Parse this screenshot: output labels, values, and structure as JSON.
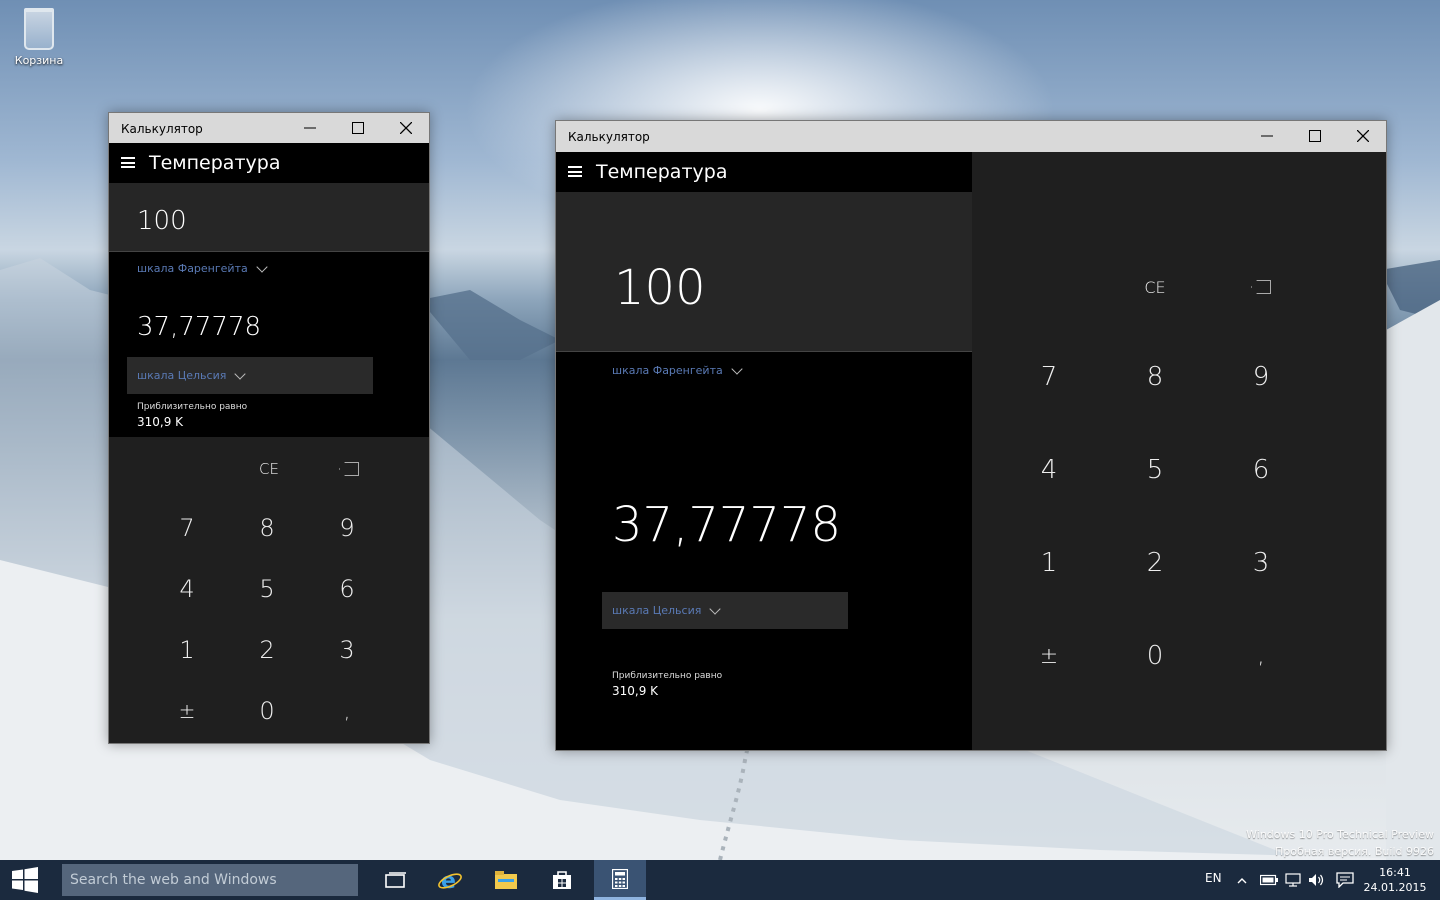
{
  "desktop": {
    "recycle_bin_label": "Корзина",
    "watermark_line1": "Windows 10 Pro Technical Preview",
    "watermark_line2": "Пробная версия. Build 9926"
  },
  "small_window": {
    "title": "Калькулятор",
    "mode": "Температура",
    "input_value": "100",
    "from_unit": "шкала Фаренгейта",
    "result_value": "37,77778",
    "to_unit": "шкала Цельсия",
    "approx_label": "Приблизительно равно",
    "approx_value": "310,9 K"
  },
  "large_window": {
    "title": "Калькулятор",
    "mode": "Температура",
    "input_value": "100",
    "from_unit": "шкала Фаренгейта",
    "result_value": "37,77778",
    "to_unit": "шкала Цельсия",
    "approx_label": "Приблизительно равно",
    "approx_value": "310,9 K"
  },
  "keypad": {
    "ce": "CE",
    "digits": [
      "7",
      "8",
      "9",
      "4",
      "5",
      "6",
      "1",
      "2",
      "3"
    ],
    "plusminus": "±",
    "zero": "0",
    "decimal": ","
  },
  "taskbar": {
    "search_placeholder": "Search the web and Windows",
    "language": "EN",
    "time": "16:41",
    "date": "24.01.2015",
    "apps": [
      "task-view",
      "internet-explorer",
      "file-explorer",
      "store",
      "calculator"
    ]
  },
  "colors": {
    "unit_accent": "#5a7ab5",
    "taskbar": "#1b2a3e",
    "calc_body": "#1f1f1f",
    "calc_panel": "#000000"
  }
}
